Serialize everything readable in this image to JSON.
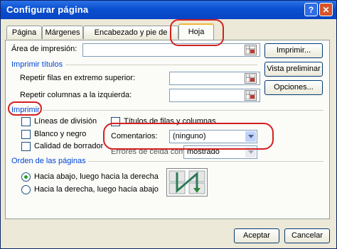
{
  "window": {
    "title": "Configurar página",
    "help_label": "?",
    "close_label": "✕"
  },
  "tabs": [
    {
      "label": "Página"
    },
    {
      "label": "Márgenes"
    },
    {
      "label": "Encabezado y pie de página"
    },
    {
      "label": "Hoja",
      "active": true
    }
  ],
  "print_area": {
    "label": "Área de impresión:",
    "value": ""
  },
  "titles_group": {
    "title": "Imprimir títulos",
    "rows_label": "Repetir filas en extremo superior:",
    "rows_value": "",
    "cols_label": "Repetir columnas a la izquierda:",
    "cols_value": ""
  },
  "print_group": {
    "title": "Imprimir",
    "gridlines_label": "Líneas de división",
    "bw_label": "Blanco y negro",
    "draft_label": "Calidad de borrador",
    "headings_label": "Títulos de filas y columnas",
    "comments_label": "Comentarios:",
    "comments_value": "(ninguno)",
    "errors_label": "Errores de celda como:",
    "errors_value": "mostrado",
    "gridlines_checked": false,
    "bw_checked": false,
    "draft_checked": false,
    "headings_checked": false
  },
  "order_group": {
    "title": "Orden de las páginas",
    "down_then_over": "Hacia abajo, luego hacia la derecha",
    "over_then_down": "Hacia la derecha, luego hacia abajo",
    "selected": "down_then_over"
  },
  "side_buttons": {
    "print": "Imprimir...",
    "preview": "Vista preliminar",
    "options": "Opciones..."
  },
  "footer_buttons": {
    "ok": "Aceptar",
    "cancel": "Cancelar"
  },
  "colors": {
    "title_bar": "#0a4fd0",
    "group_title": "#0046d5",
    "annotation": "#d42020",
    "dialog_bg": "#ece9d8"
  }
}
